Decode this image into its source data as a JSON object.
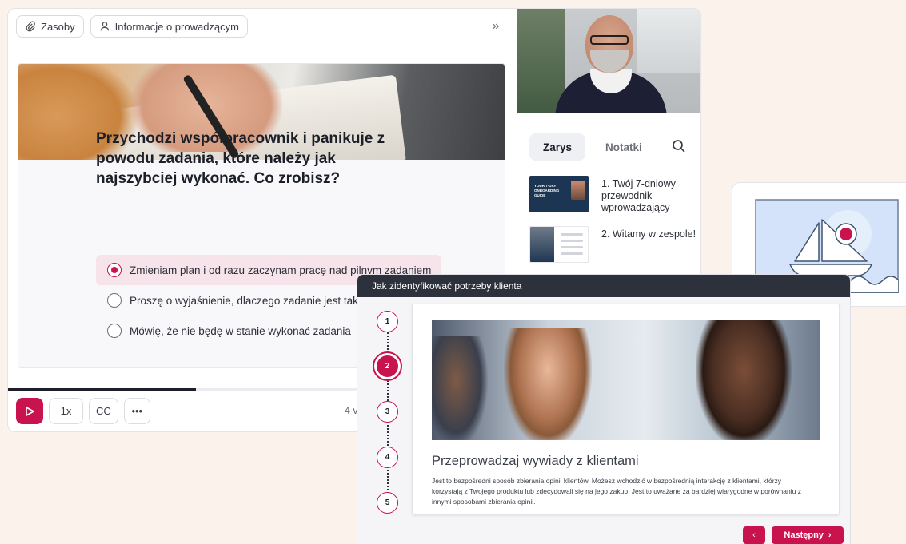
{
  "player": {
    "toolbar": {
      "resources_label": "Zasoby",
      "instructor_label": "Informacje o prowadzącym"
    },
    "question": "Przychodzi współpracownik i panikuje z powodu zadania, które należy jak najszybciej wykonać. Co zrobisz?",
    "answers": [
      {
        "label": "Zmieniam plan i od razu zaczynam pracę nad pilnym zadaniem",
        "selected": true
      },
      {
        "label": "Proszę o wyjaśnienie, dlaczego zadanie jest tak",
        "selected": false
      },
      {
        "label": "Mówię, że nie będę w stanie wykonać zadania",
        "selected": false
      }
    ],
    "progress_percent": 37,
    "controls": {
      "speed": "1x",
      "captions": "CC",
      "more": "•••"
    },
    "time_label": "4 v",
    "icons": {
      "resources": "paperclip-icon",
      "instructor": "user-icon",
      "collapse": "double-chevron-right-icon",
      "play": "play-icon",
      "search": "search-icon"
    }
  },
  "sidebar": {
    "tabs": [
      {
        "label": "Zarys",
        "active": true
      },
      {
        "label": "Notatki",
        "active": false
      }
    ],
    "outline": [
      {
        "label": "1. Twój 7-dniowy przewodnik wprowadzający",
        "thumb_text": "YOUR 7-DAY ONBOARDING GUIDE"
      },
      {
        "label": "2. Witamy w zespole!"
      }
    ]
  },
  "course": {
    "header": "Jak zidentyfikować potrzeby klienta",
    "steps": [
      "1",
      "2",
      "3",
      "4",
      "5"
    ],
    "active_step": 2,
    "title": "Przeprowadzaj wywiady z klientami",
    "text": "Jest to bezpośredni sposób zbierania opinii klientów. Możesz wchodzić w bezpośrednią interakcję z klientami, którzy korzystają z Twojego produktu lub zdecydowali się na jego zakup. Jest to uważane za bardziej wiarygodne w porównaniu z innymi sposobami zbierania opinii.",
    "next_label": "Następny"
  },
  "colors": {
    "accent": "#c8134f",
    "background": "#fcf2ec",
    "header_dark": "#2c313b"
  }
}
